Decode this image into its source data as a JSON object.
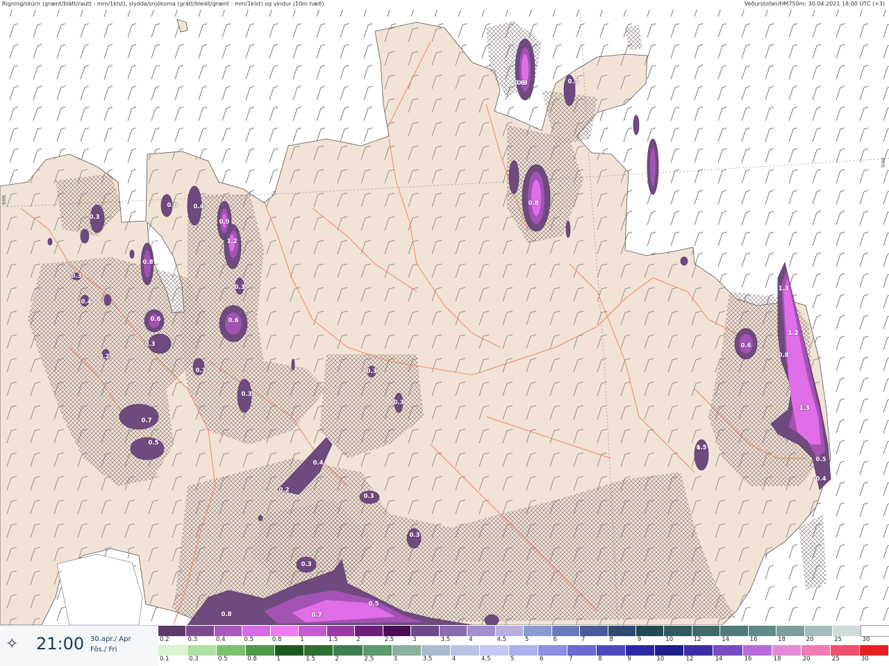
{
  "header": {
    "left": "Rigning/skúrir (grænt/blátt/rautt - mm/1klst), slydda/snjókoma (grátt/bleikt/grænt - mm/1klst) og vindur (10m hæð)",
    "right": "Veðurstofan/HM750m: 30.04.2021 18:00 UTC (+3)"
  },
  "gridlabels": {
    "left": "66N",
    "right": "66N"
  },
  "time_panel": {
    "icon": "wind-compass-icon",
    "time": "21:00",
    "date": "30.apr./ Apr",
    "day": "Fös./ Fri"
  },
  "legend": {
    "snow": {
      "ticks": [
        "0.2",
        "0.3",
        "0.4",
        "0.5",
        "0.8",
        "1",
        "1.5",
        "2",
        "2.5",
        "3",
        "3.5",
        "4",
        "4.5",
        "5",
        "6",
        "7",
        "8",
        "9",
        "10",
        "12",
        "14",
        "16",
        "18",
        "20",
        "25",
        "30"
      ],
      "colors": [
        "#5c3a6a",
        "#7c4a8e",
        "#a858b8",
        "#d86ae4",
        "#ee7af4",
        "#c85ad0",
        "#9a3aa6",
        "#6e1e7a",
        "#4a0e56",
        "#6a4a8a",
        "#8a6ab0",
        "#a28ed0",
        "#b8aee4",
        "#8a9ad2",
        "#6a7aba",
        "#4a5a9a",
        "#2e4a6e",
        "#1e4a52",
        "#2e5a5e",
        "#3e6a6a",
        "#4e7a7a",
        "#5e8a8a",
        "#7e9e9e",
        "#a6bcbc",
        "#cedcdc",
        "#ffffff"
      ]
    },
    "rain": {
      "ticks": [
        "0.1",
        "0.3",
        "0.5",
        "0.8",
        "1",
        "1.5",
        "2",
        "2.5",
        "3",
        "3.5",
        "4",
        "4.5",
        "5",
        "6",
        "7",
        "8",
        "9",
        "10",
        "12",
        "14",
        "16",
        "18",
        "20",
        "25",
        "30"
      ],
      "colors": [
        "#d8f4d0",
        "#b0e0a4",
        "#7cc26e",
        "#4e9a46",
        "#1e5a1e",
        "#2e6e2e",
        "#3e7e4e",
        "#5a9a6e",
        "#8ab0a0",
        "#a8bcd0",
        "#b8c4e4",
        "#c4c8f4",
        "#aab0f0",
        "#8a8ee4",
        "#6a6ad4",
        "#4a4ac0",
        "#2a2aa6",
        "#1e1e8e",
        "#3e2ea6",
        "#7a4ac4",
        "#b86ad8",
        "#e48ad6",
        "#f07ab4",
        "#ee5070",
        "#e82020"
      ]
    }
  },
  "contour_labels": [
    "0.3",
    "0.3",
    "0.4",
    "0.6",
    "0.9",
    "1.2",
    "0.3",
    "0.6",
    "0.3",
    "0.4",
    "0.6",
    "0.3",
    "0.8",
    "0.3",
    "0.2",
    "0.7",
    "0.5",
    "0.3",
    "0.4",
    "0.2",
    "0.3",
    "0.3",
    "0.3",
    "0.3",
    "0.8",
    "0.9",
    "0.8",
    "0.7",
    "0.5",
    "0.6",
    "0.4",
    "0.6",
    "1.3",
    "1.2",
    "0.8",
    "1.3",
    "0.5",
    "0.4",
    "0.5",
    "1.5",
    "0.3"
  ]
}
